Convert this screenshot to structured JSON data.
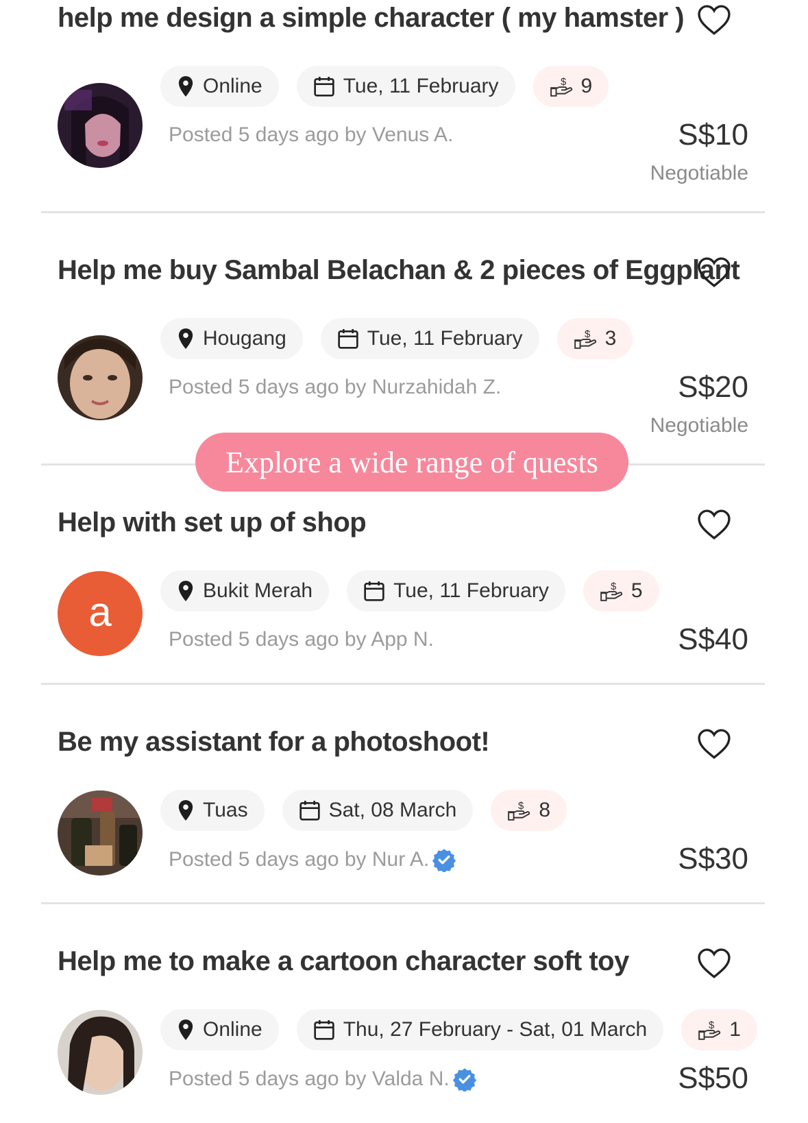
{
  "banner": {
    "text": "Explore a wide range of quests",
    "color": "#f7889c"
  },
  "quests": [
    {
      "title": "help me design a simple character ( my hamster )",
      "location": "Online",
      "date": "Tue, 11 February",
      "offers": "9",
      "posted": "Posted 5 days ago by Venus A.",
      "price": "S$10",
      "negotiable": "Negotiable",
      "avatar": "photo"
    },
    {
      "title": "Help me buy Sambal Belachan & 2 pieces of Eggplant",
      "location": "Hougang",
      "date": "Tue, 11 February",
      "offers": "3",
      "posted": "Posted 5 days ago by Nurzahidah Z.",
      "price": "S$20",
      "negotiable": "Negotiable",
      "avatar": "photo"
    },
    {
      "title": "Help with set up of shop",
      "location": "Bukit Merah",
      "date": "Tue, 11 February",
      "offers": "5",
      "posted": "Posted 5 days ago by App N.",
      "price": "S$40",
      "avatar_letter": "a",
      "avatar_color": "#e85d35"
    },
    {
      "title": "Be my assistant for a photoshoot!",
      "location": "Tuas",
      "date": "Sat, 08 March",
      "offers": "8",
      "posted": "Posted 5 days ago by Nur A.",
      "price": "S$30",
      "verified": true,
      "avatar": "photo"
    },
    {
      "title": "Help me to make a cartoon character soft toy",
      "location": "Online",
      "date": "Thu, 27 February - Sat, 01 March",
      "offers": "1",
      "posted": "Posted 5 days ago by Valda N.",
      "price": "S$50",
      "verified": true,
      "avatar": "photo"
    }
  ],
  "icons": {
    "location": "map-pin-icon",
    "date": "calendar-icon",
    "offers": "hand-coin-icon",
    "favorite": "heart-icon",
    "verified": "verified-badge-icon"
  },
  "colors": {
    "verified": "#4a90e2",
    "offers_chip_bg": "#fff1ef"
  }
}
